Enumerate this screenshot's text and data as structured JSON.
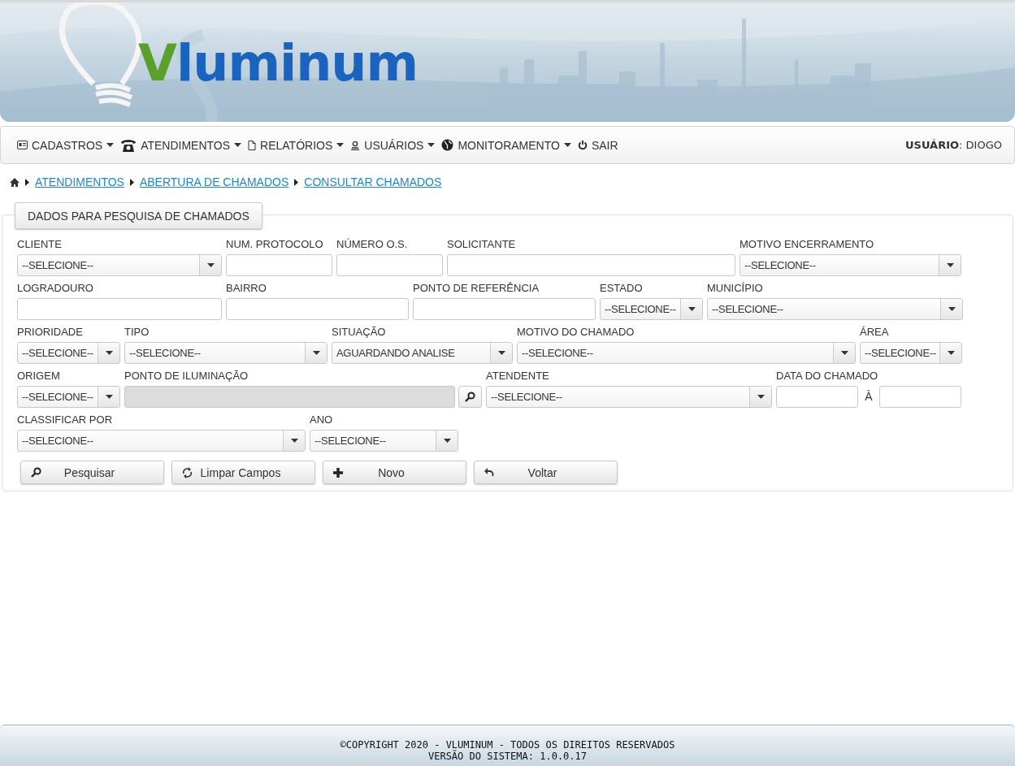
{
  "logo": {
    "first": "V",
    "rest": "luminum"
  },
  "menu": [
    {
      "label": "CADASTROS",
      "dropdown": true
    },
    {
      "label": "ATENDIMENTOS",
      "dropdown": true
    },
    {
      "label": "RELATÓRIOS",
      "dropdown": true
    },
    {
      "label": "USUÁRIOS",
      "dropdown": true
    },
    {
      "label": "MONITORAMENTO",
      "dropdown": true
    },
    {
      "label": "SAIR",
      "dropdown": false
    }
  ],
  "user": "**USUÁRIO**: DIOGO",
  "breadcrumb": [
    "ATENDIMENTOS",
    "ABERTURA DE CHAMADOS",
    "CONSULTAR CHAMADOS"
  ],
  "panel_title": "DADOS PARA PESQUISA DE CHAMADOS",
  "rows": [
    [
      {
        "label": "CLIENTE",
        "kind": "select",
        "value": "--SELECIONE--"
      },
      {
        "label": "NUM. PROTOCOLO",
        "kind": "text"
      },
      {
        "label": "NÚMERO O.S.",
        "kind": "text"
      },
      {
        "label": "SOLICITANTE",
        "kind": "text"
      },
      {
        "label": "MOTIVO ENCERRAMENTO",
        "kind": "select",
        "value": "--SELECIONE--"
      }
    ],
    [
      {
        "label": "LOGRADOURO",
        "kind": "text"
      },
      {
        "label": "BAIRRO",
        "kind": "text"
      },
      {
        "label": "PONTO DE REFERÊNCIA",
        "kind": "text"
      },
      {
        "label": "ESTADO",
        "kind": "select",
        "value": "--SELECIONE--"
      },
      {
        "label": "MUNICÍPIO",
        "kind": "select",
        "value": "--SELECIONE--"
      }
    ],
    [
      {
        "label": "PRIORIDADE",
        "kind": "select",
        "value": "--SELECIONE--"
      },
      {
        "label": "TIPO",
        "kind": "select",
        "value": "--SELECIONE--"
      },
      {
        "label": "SITUAÇÃO",
        "kind": "select",
        "value": "AGUARDANDO ANALISE"
      },
      {
        "label": "MOTIVO DO CHAMADO",
        "kind": "select",
        "value": "--SELECIONE--"
      },
      {
        "label": "ÁREA",
        "kind": "select",
        "value": "--SELECIONE--"
      }
    ],
    [
      {
        "label": "ORIGEM",
        "kind": "select",
        "value": "--SELECIONE--"
      },
      {
        "label": "PONTO DE ILUMINAÇÃO",
        "kind": "lookup",
        "disabled": true
      },
      {
        "label": "ATENDENTE",
        "kind": "select",
        "value": "--SELECIONE--"
      },
      {
        "label": "DATA DO CHAMADO",
        "kind": "range",
        "separator": "À"
      }
    ],
    [
      {
        "label": "CLASSIFICAR POR",
        "kind": "select",
        "value": "--SELECIONE--"
      },
      {
        "label": "ANO",
        "kind": "select",
        "value": "--SELECIONE--"
      }
    ]
  ],
  "buttons": [
    "Pesquisar",
    "Limpar Campos",
    "Novo",
    "Voltar"
  ],
  "footer": [
    "©COPYRIGHT 2020 - VLUMINUM - TODOS OS DIREITOS RESERVADOS",
    "VERSÃO DO SISTEMA: 1.0.0.17"
  ]
}
